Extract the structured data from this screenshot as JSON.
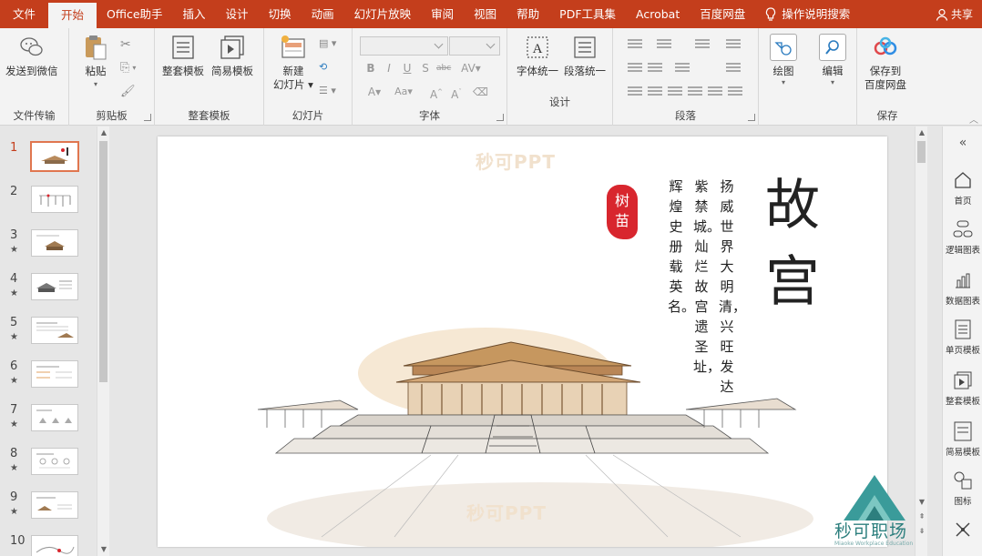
{
  "menubar": {
    "items": [
      "文件",
      "开始",
      "Office助手",
      "插入",
      "设计",
      "切换",
      "动画",
      "幻灯片放映",
      "审阅",
      "视图",
      "帮助",
      "PDF工具集",
      "Acrobat",
      "百度网盘"
    ],
    "search_label": "操作说明搜索",
    "share_label": "共享"
  },
  "ribbon": {
    "file_transfer": {
      "send_wechat": "发送到微信",
      "group": "文件传输"
    },
    "clipboard": {
      "paste": "粘贴",
      "group": "剪贴板"
    },
    "templates": {
      "full": "整套模板",
      "simple": "简易模板",
      "group": "整套模板"
    },
    "slides": {
      "new_slide_line1": "新建",
      "new_slide_line2": "幻灯片",
      "group": "幻灯片"
    },
    "font": {
      "group": "字体",
      "size_label": "Aa"
    },
    "design": {
      "font_unify": "字体统一",
      "para_unify": "段落统一",
      "group": "设计"
    },
    "paragraph": {
      "group": "段落"
    },
    "drawing": {
      "label": "绘图"
    },
    "editing": {
      "label": "编辑"
    },
    "save": {
      "line1": "保存到",
      "line2": "百度网盘",
      "group": "保存"
    }
  },
  "thumbnails": [
    {
      "num": "1",
      "star": ""
    },
    {
      "num": "2",
      "star": ""
    },
    {
      "num": "3",
      "star": "★"
    },
    {
      "num": "4",
      "star": "★"
    },
    {
      "num": "5",
      "star": "★"
    },
    {
      "num": "6",
      "star": "★"
    },
    {
      "num": "7",
      "star": "★"
    },
    {
      "num": "8",
      "star": "★"
    },
    {
      "num": "9",
      "star": "★"
    },
    {
      "num": "10",
      "star": ""
    }
  ],
  "slide": {
    "watermark": "秒可PPT",
    "title_chars": [
      "故",
      "宫"
    ],
    "text_columns": [
      "扬威世界大明清，兴旺发达",
      "紫禁城。灿烂故宫遗圣址，",
      "辉煌史册载英名。"
    ],
    "seal_chars": [
      "树",
      "苗"
    ]
  },
  "right_panel": {
    "items": [
      "首页",
      "逻辑图表",
      "数据图表",
      "单页模板",
      "整套模板",
      "简易模板",
      "图标"
    ]
  },
  "brand": {
    "name": "秒可职场",
    "tagline": "Miaoke Workplace Education"
  },
  "colors": {
    "accent": "#c43e1c",
    "seal": "#d8262e",
    "logo": "#3a9b9a"
  }
}
